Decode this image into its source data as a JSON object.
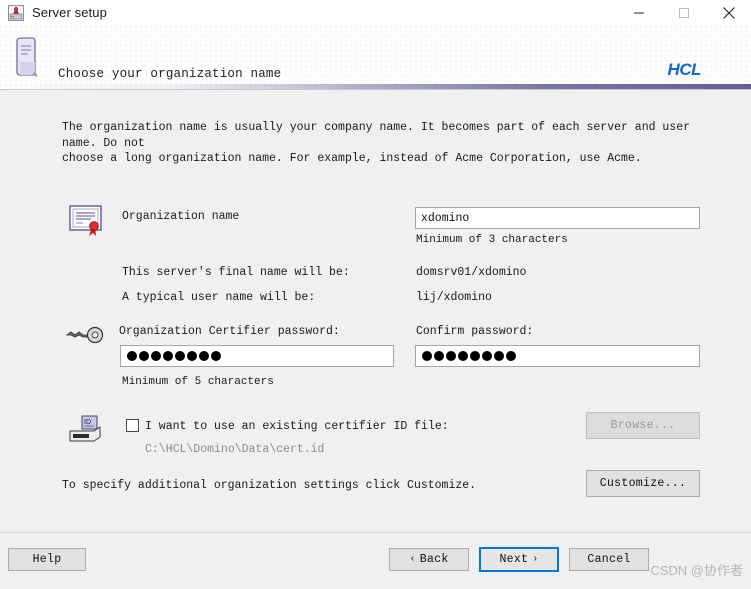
{
  "window": {
    "title": "Server setup",
    "icon": "server-setup-icon",
    "controls": {
      "minimize": "minimize-icon",
      "maximize": "maximize-icon",
      "close": "close-icon"
    }
  },
  "header": {
    "title": "Choose your organization name",
    "brand": "HCL",
    "brand_color": "#1668c8",
    "icon": "document-scroll-icon"
  },
  "intro": {
    "text": "The organization name is usually your company name. It becomes part of each server and user name. Do not\nchoose a long organization name. For example, instead of Acme Corporation, use Acme."
  },
  "organization": {
    "icon": "certificate-icon",
    "label": "Organization name",
    "value": "xdomino",
    "placeholder": "",
    "hint": "Minimum of 3 characters",
    "server_name_label": "This server's final name will be:",
    "server_name_value": "domsrv01/xdomino",
    "user_name_label": "A typical user name will be:",
    "user_name_value": "lij/xdomino"
  },
  "password": {
    "icon": "key-icon",
    "certifier_label": "Organization Certifier password:",
    "certifier_masked_length": 8,
    "certifier_hint": "Minimum of 5 characters",
    "confirm_label": "Confirm password:",
    "confirm_masked_length": 8
  },
  "certifier_id": {
    "icon": "id-card-reader-icon",
    "checkbox_label": "I want to use an existing certifier ID file:",
    "checked": false,
    "path_value": "C:\\HCL\\Domino\\Data\\cert.id",
    "browse_label": "Browse...",
    "browse_disabled": true
  },
  "customize": {
    "note": "To specify additional organization settings click Customize.",
    "button_label": "Customize..."
  },
  "footer": {
    "help_label": "Help",
    "back_label": "Back",
    "back_chevron": "‹",
    "next_label": "Next",
    "next_chevron": "›",
    "cancel_label": "Cancel",
    "focused_button": "next"
  },
  "watermark": {
    "text": "CSDN @协作者"
  }
}
